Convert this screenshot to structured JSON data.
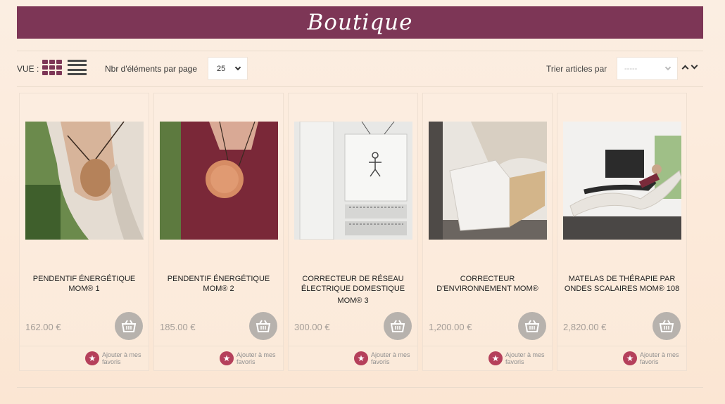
{
  "banner": {
    "title": "Boutique"
  },
  "toolbar": {
    "view_label": "VUE :",
    "per_page_label": "Nbr d'éléments par page",
    "per_page_value": "25",
    "sort_label": "Trier articles par",
    "sort_value": "-----"
  },
  "products": [
    {
      "name_line1": "PENDENTIF ÉNERGÉTIQUE",
      "name_line2": "MOM® 1",
      "name_line3": "",
      "price": "162.00 €",
      "fav_label": "Ajouter à mes favoris"
    },
    {
      "name_line1": "PENDENTIF ÉNERGÉTIQUE",
      "name_line2": "MOM® 2",
      "name_line3": "",
      "price": "185.00 €",
      "fav_label": "Ajouter à mes favoris"
    },
    {
      "name_line1": "CORRECTEUR DE RÉSEAU",
      "name_line2": "ÉLECTRIQUE DOMESTIQUE",
      "name_line3": "MOM® 3",
      "price": "300.00 €",
      "fav_label": "Ajouter à mes favoris"
    },
    {
      "name_line1": "CORRECTEUR",
      "name_line2": "D'ENVIRONNEMENT MOM®",
      "name_line3": "",
      "price": "1,200.00 €",
      "fav_label": "Ajouter à mes favoris"
    },
    {
      "name_line1": "MATELAS DE THÉRAPIE PAR",
      "name_line2": "ONDES SCALAIRES MOM® 108",
      "name_line3": "",
      "price": "2,820.00 €",
      "fav_label": "Ajouter à mes favoris"
    }
  ],
  "colors": {
    "brand": "#7d3656",
    "favorite": "#b5405b",
    "cart": "#b7b2ad"
  }
}
